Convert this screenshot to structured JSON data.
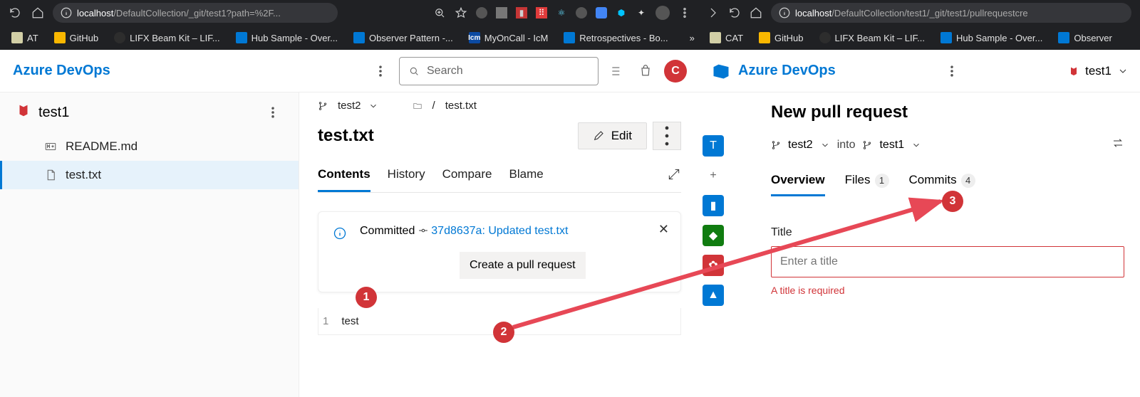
{
  "chrome_left": {
    "url_host": "localhost",
    "url_path": "/DefaultCollection/_git/test1?path=%2F...",
    "bookmarks": [
      "AT",
      "GitHub",
      "LIFX Beam Kit – LIF...",
      "Hub Sample - Over...",
      "Observer Pattern -...",
      "MyOnCall - IcM",
      "Retrospectives - Bo..."
    ],
    "bookmark_colors": [
      "#d2cfa6",
      "#f9b700",
      "#2d2d2d",
      "#0078d4",
      "#0078d4",
      "#0b4aa2",
      "#0078d4"
    ]
  },
  "chrome_right": {
    "url_host": "localhost",
    "url_path": "/DefaultCollection/test1/_git/test1/pullrequestcre",
    "bookmarks": [
      "CAT",
      "GitHub",
      "LIFX Beam Kit – LIF...",
      "Hub Sample - Over...",
      "Observer"
    ],
    "bookmark_colors": [
      "#d2cfa6",
      "#f9b700",
      "#2d2d2d",
      "#0078d4",
      "#0078d4"
    ]
  },
  "header": {
    "brand": "Azure DevOps",
    "search_placeholder": "Search",
    "avatar": "C"
  },
  "sidebar": {
    "repo": "test1",
    "files": [
      "README.md",
      "test.txt"
    ],
    "selected": "test.txt"
  },
  "crumb": {
    "branch": "test2",
    "file": "test.txt"
  },
  "title": "test.txt",
  "edit_label": "Edit",
  "tabs": [
    "Contents",
    "History",
    "Compare",
    "Blame"
  ],
  "notice": {
    "word": "Committed",
    "commit": "37d8637a: Updated test.txt",
    "button": "Create a pull request"
  },
  "code": {
    "line_no": "1",
    "text": "test"
  },
  "rail": [
    {
      "bg": "#0078d4",
      "txt": "T"
    },
    {
      "bg": "#fff",
      "txt": "+",
      "fg": "#666"
    },
    {
      "bg": "#0078d4",
      "txt": "▮"
    },
    {
      "bg": "#107c10",
      "txt": "◆"
    },
    {
      "bg": "#d13438",
      "txt": "✿"
    },
    {
      "bg": "#0078d4",
      "txt": "▲"
    }
  ],
  "right": {
    "repo_name": "test1",
    "heading": "New pull request",
    "src_branch": "test2",
    "into": "into",
    "dst_branch": "test1",
    "tabs": [
      {
        "label": "Overview",
        "count": null,
        "active": true
      },
      {
        "label": "Files",
        "count": "1",
        "active": false
      },
      {
        "label": "Commits",
        "count": "4",
        "active": false
      }
    ],
    "title_label": "Title",
    "title_placeholder": "Enter a title",
    "title_error": "A title is required"
  },
  "annotations": [
    "1",
    "2",
    "3"
  ]
}
